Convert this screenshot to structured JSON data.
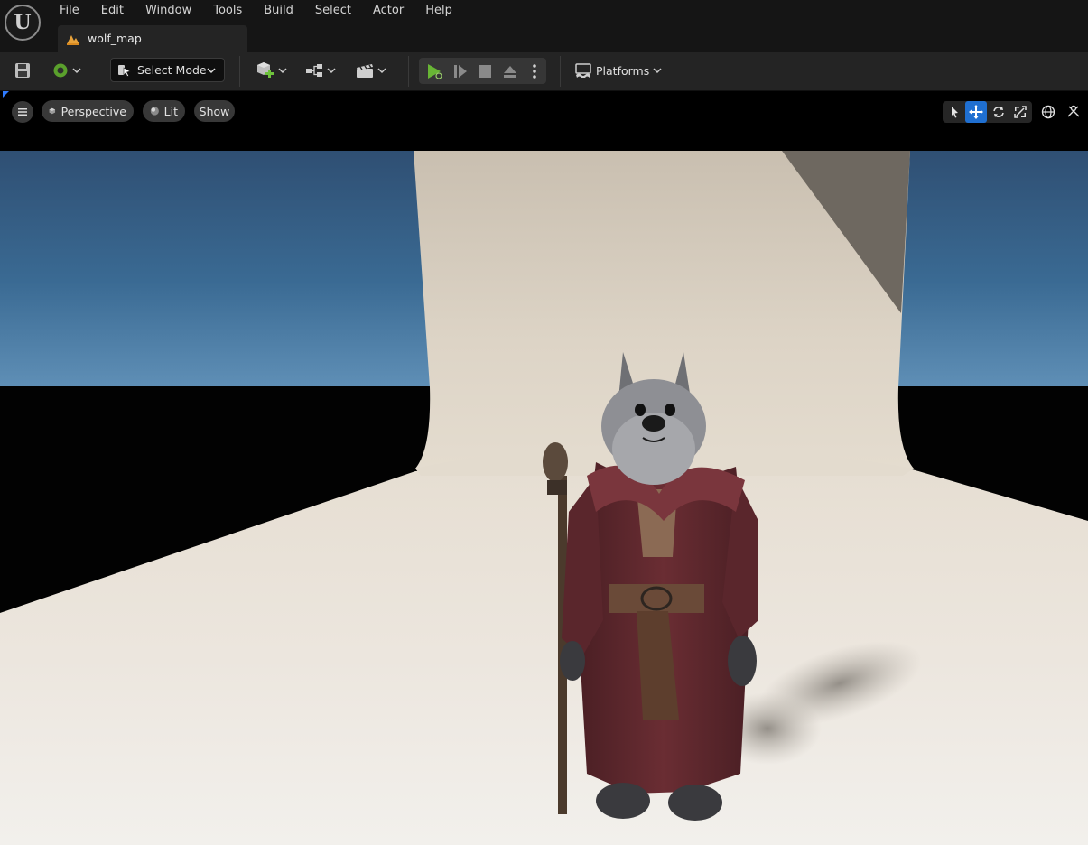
{
  "menu": {
    "items": [
      "File",
      "Edit",
      "Window",
      "Tools",
      "Build",
      "Select",
      "Actor",
      "Help"
    ]
  },
  "tab": {
    "label": "wolf_map"
  },
  "toolbar": {
    "mode_label": "Select Mode",
    "platforms_label": "Platforms"
  },
  "viewport": {
    "view_mode_label": "Perspective",
    "lighting_label": "Lit",
    "show_label": "Show",
    "active_tool": "translate",
    "accent_color": "#1f6fd1"
  },
  "icons": {
    "menu": "unreal-logo-icon",
    "tab": "level-icon",
    "save": "save-icon",
    "source_control": "source-control-icon",
    "add": "add-actor-icon",
    "blueprint": "blueprint-icon",
    "cinematics": "cinematics-icon",
    "play": "play-icon",
    "advance": "advance-frame-icon",
    "stop": "stop-icon",
    "eject": "eject-icon",
    "options": "kebab-icon"
  }
}
